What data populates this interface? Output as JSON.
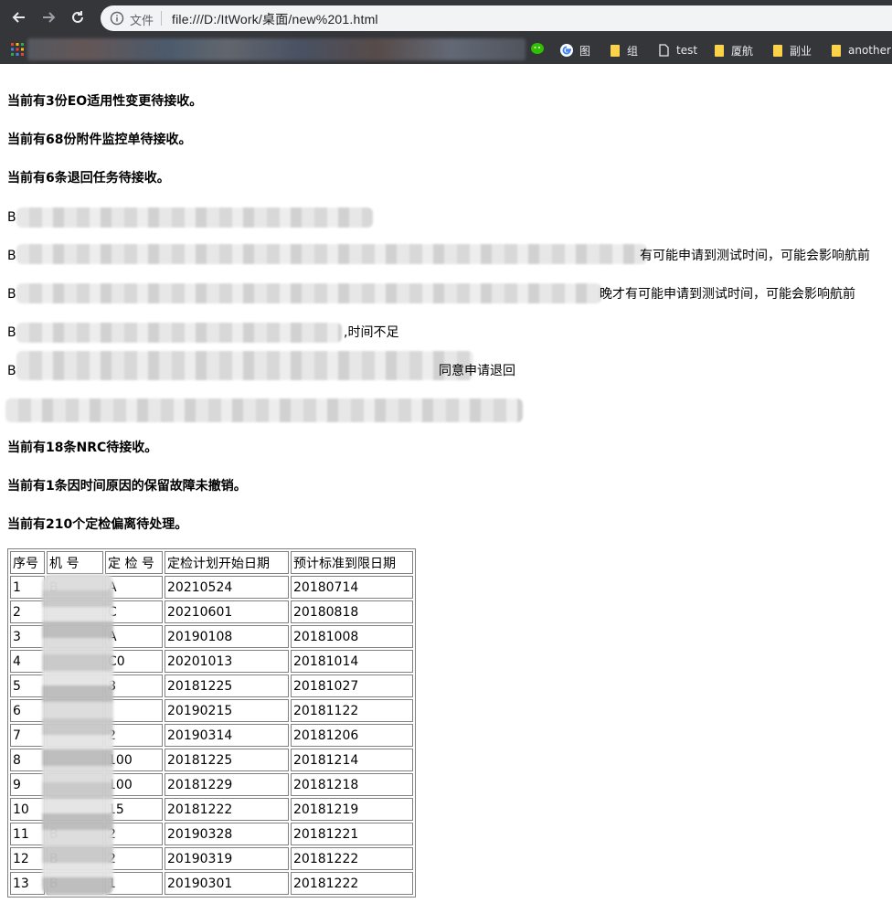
{
  "browser": {
    "address_label": "文件",
    "url": "file:///D:/ItWork/桌面/new%201.html",
    "bookmarks": [
      {
        "label": "图",
        "icon": "google-icon"
      },
      {
        "label": "组",
        "icon": "folder-icon"
      },
      {
        "label": "test",
        "icon": "page-icon"
      },
      {
        "label": "厦航",
        "icon": "folder-icon"
      },
      {
        "label": "副业",
        "icon": "folder-icon"
      },
      {
        "label": "another",
        "icon": "folder-icon"
      }
    ]
  },
  "summary": {
    "eo": "当前有3份EO适用性变更待接收。",
    "attachment": "当前有68份附件监控单待接收。",
    "returned": "当前有6条退回任务待接收。"
  },
  "returned_items": [
    "B",
    "B",
    "B",
    "B",
    "B",
    ""
  ],
  "returned_visible_tail": [
    "",
    "有可能申请到测试时间，可能会影响航前",
    "晚才有可能申请到测试时间，可能会影响航前",
    ",时间不足",
    "同意申请退回",
    ""
  ],
  "summary2": {
    "nrc": "当前有18条NRC待接收。",
    "deferred": "当前有1条因时间原因的保留故障未撤销。",
    "deviation": "当前有210个定检偏离待处理。"
  },
  "table": {
    "headers": [
      "序号",
      "机 号",
      "定 检 号",
      "定检计划开始日期",
      "预计标准到限日期"
    ],
    "rows": [
      [
        "1",
        "B",
        "A",
        "20210524",
        "20180714"
      ],
      [
        "2",
        "",
        "C",
        "20210601",
        "20180818"
      ],
      [
        "3",
        "",
        "A",
        "20190108",
        "20181008"
      ],
      [
        "4",
        "",
        "C0",
        "20201013",
        "20181014"
      ],
      [
        "5",
        "",
        "8",
        "20181225",
        "20181027"
      ],
      [
        "6",
        "",
        "",
        "20190215",
        "20181122"
      ],
      [
        "7",
        "",
        "2",
        "20190314",
        "20181206"
      ],
      [
        "8",
        "",
        "100",
        "20181225",
        "20181214"
      ],
      [
        "9",
        "",
        "100",
        "20181229",
        "20181218"
      ],
      [
        "10",
        "",
        "15",
        "20181222",
        "20181219"
      ],
      [
        "11",
        "B",
        "2",
        "20190328",
        "20181221"
      ],
      [
        "12",
        "B",
        "2",
        "20190319",
        "20181222"
      ],
      [
        "13",
        "B",
        "1",
        "20190301",
        "20181222"
      ]
    ]
  }
}
